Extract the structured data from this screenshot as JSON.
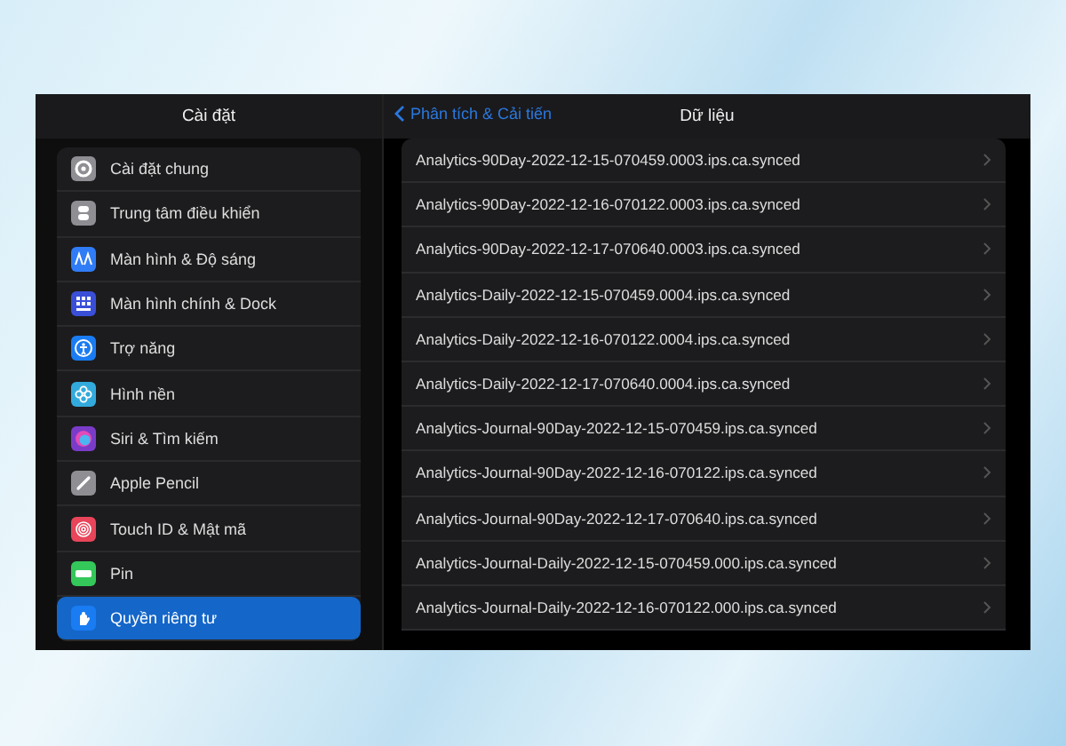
{
  "sidebar": {
    "title": "Cài đặt",
    "items": [
      {
        "label": "Cài đặt chung",
        "color": "#8e8e93",
        "selected": false
      },
      {
        "label": "Trung tâm điều khiển",
        "color": "#8e8e93",
        "selected": false
      },
      {
        "label": "Màn hình & Độ sáng",
        "color": "#2f7cf6",
        "selected": false
      },
      {
        "label": "Màn hình chính & Dock",
        "color": "#3a4fd8",
        "selected": false
      },
      {
        "label": "Trợ năng",
        "color": "#1a7cf2",
        "selected": false
      },
      {
        "label": "Hình nền",
        "color": "#33aadd",
        "selected": false
      },
      {
        "label": "Siri & Tìm kiếm",
        "color": "#7a3cc8",
        "selected": false
      },
      {
        "label": "Apple Pencil",
        "color": "#8e8e93",
        "selected": false
      },
      {
        "label": "Touch ID & Mật mã",
        "color": "#e8455a",
        "selected": false
      },
      {
        "label": "Pin",
        "color": "#34c759",
        "selected": false
      },
      {
        "label": "Quyền riêng tư",
        "color": "#1a7cf2",
        "selected": true
      }
    ]
  },
  "detail": {
    "back": "Phân tích & Cải tiến",
    "title": "Dữ liệu",
    "files": [
      "Analytics-90Day-2022-12-15-070459.0003.ips.ca.synced",
      "Analytics-90Day-2022-12-16-070122.0003.ips.ca.synced",
      "Analytics-90Day-2022-12-17-070640.0003.ips.ca.synced",
      "Analytics-Daily-2022-12-15-070459.0004.ips.ca.synced",
      "Analytics-Daily-2022-12-16-070122.0004.ips.ca.synced",
      "Analytics-Daily-2022-12-17-070640.0004.ips.ca.synced",
      "Analytics-Journal-90Day-2022-12-15-070459.ips.ca.synced",
      "Analytics-Journal-90Day-2022-12-16-070122.ips.ca.synced",
      "Analytics-Journal-90Day-2022-12-17-070640.ips.ca.synced",
      "Analytics-Journal-Daily-2022-12-15-070459.000.ips.ca.synced",
      "Analytics-Journal-Daily-2022-12-16-070122.000.ips.ca.synced"
    ]
  }
}
